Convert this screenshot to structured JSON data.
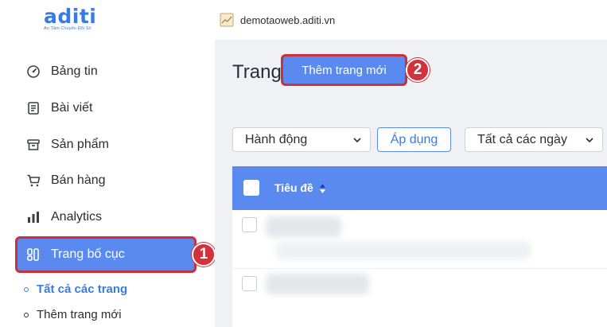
{
  "brand": {
    "logo_text": "aditi",
    "tagline": "An Tâm Chuyển Đổi Số"
  },
  "topbar": {
    "site_icon": "chart-icon",
    "domain": "demotaoweb.aditi.vn"
  },
  "sidebar": {
    "items": [
      {
        "label": "Bảng tin",
        "icon": "dashboard-icon"
      },
      {
        "label": "Bài viết",
        "icon": "document-icon"
      },
      {
        "label": "Sản phẩm",
        "icon": "archive-icon"
      },
      {
        "label": "Bán hàng",
        "icon": "cart-icon"
      },
      {
        "label": "Analytics",
        "icon": "bar-chart-icon"
      },
      {
        "label": "Trang bố cục",
        "icon": "layout-icon",
        "active": true
      }
    ],
    "subitems": [
      {
        "label": "Tất cả các trang",
        "current": true
      },
      {
        "label": "Thêm trang mới"
      }
    ]
  },
  "main": {
    "title": "Trang",
    "add_new_label": "Thêm trang mới",
    "filters": {
      "bulk_action": "Hành động",
      "apply_label": "Áp dụng",
      "date_filter": "Tất cả các ngày"
    },
    "table": {
      "column_title": "Tiêu đề"
    }
  },
  "annotations": {
    "step1": "1",
    "step2": "2"
  },
  "colors": {
    "accent": "#5a8af0",
    "highlight_border": "#c8323c",
    "badge": "#d2323c",
    "brand": "#3a7ae6"
  }
}
